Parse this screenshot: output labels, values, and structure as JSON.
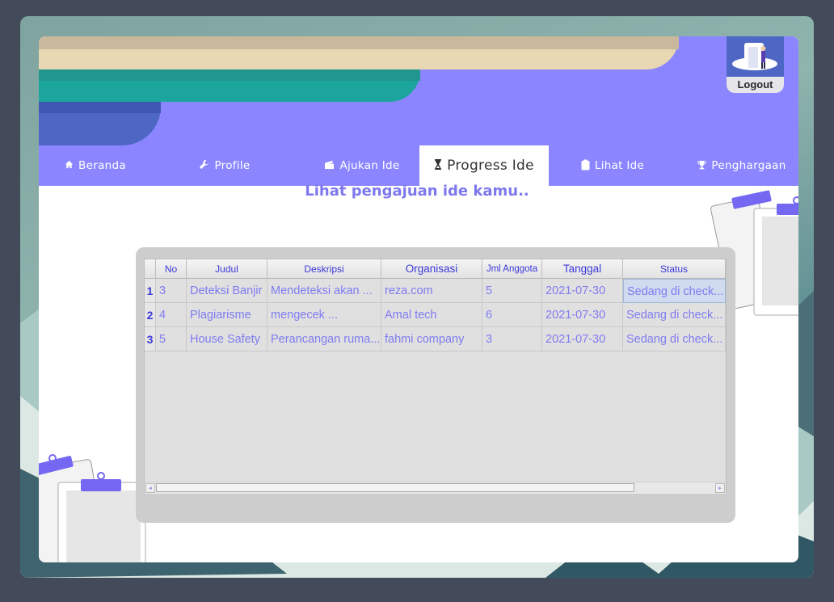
{
  "header": {
    "logout_label": "Logout"
  },
  "nav": {
    "tabs": [
      {
        "label": "Beranda",
        "icon": "home-icon"
      },
      {
        "label": "Profile",
        "icon": "wrench-icon"
      },
      {
        "label": "Ajukan Ide",
        "icon": "clapperboard-icon"
      },
      {
        "label": "Progress Ide",
        "icon": "hourglass-icon"
      },
      {
        "label": "Lihat Ide",
        "icon": "clipboard-icon"
      },
      {
        "label": "Penghargaan",
        "icon": "trophy-icon"
      }
    ],
    "active": "Progress Ide"
  },
  "main": {
    "heading": "Lihat pengajuan ide kamu.."
  },
  "table": {
    "columns": [
      "No",
      "Judul",
      "Deskripsi",
      "Organisasi",
      "Jml Anggota",
      "Tanggal",
      "Status"
    ],
    "rows": [
      {
        "row_header": "1",
        "no": "3",
        "judul": "Deteksi Banjir",
        "deskripsi": "Mendeteksi akan ...",
        "organisasi": "reza.com",
        "jml_anggota": "5",
        "tanggal": "2021-07-30",
        "status": "Sedang di check..."
      },
      {
        "row_header": "2",
        "no": "4",
        "judul": "Plagiarisme",
        "deskripsi": "mengecek ...",
        "organisasi": "Amal tech",
        "jml_anggota": "6",
        "tanggal": "2021-07-30",
        "status": "Sedang di check..."
      },
      {
        "row_header": "3",
        "no": "5",
        "judul": "House Safety",
        "deskripsi": "Perancangan ruma...",
        "organisasi": "fahmi company",
        "jml_anggota": "3",
        "tanggal": "2021-07-30",
        "status": "Sedang di check..."
      }
    ],
    "selected_cell": {
      "row": 0,
      "column": "Status"
    }
  },
  "colors": {
    "background": "#434b5b",
    "banner": "#8b86ff",
    "accent_text": "#7e78ee",
    "header_text": "#3b39d8",
    "cell_text": "#7f7cf0"
  }
}
